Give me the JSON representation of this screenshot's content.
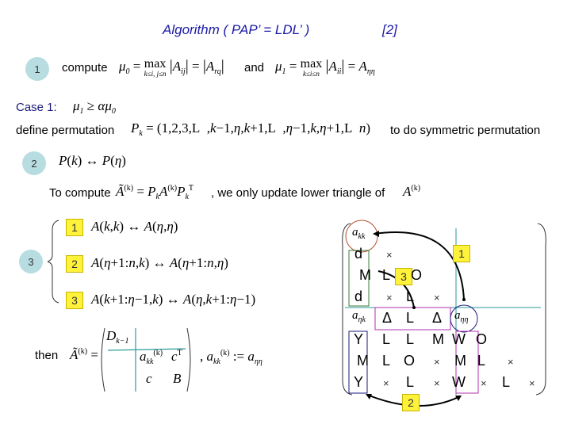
{
  "title": "Algorithm ( PAP’ = LDL’ )",
  "reference": "[2]",
  "step1": {
    "badge": "1",
    "label": "compute",
    "mu0_lhs": "μ₀ =",
    "max_op": "max",
    "mu0_limits": "k≤i, j≤n",
    "mu0_rhs": "|A_ij| = |A_rq|",
    "and_label": "and",
    "mu1_lhs": "μ₁ =",
    "mu1_limits": "k≤i≤n",
    "mu1_rhs": "|A_ii| = A_ηη"
  },
  "case1": {
    "label": "Case 1:",
    "condition": "μ₁ ≥ αμ₀"
  },
  "permutation": {
    "label": "define permutation",
    "formula": "P_k = (1,2,3,L ,k−1,η,k+1,L ,η−1,k,η+1,L n)",
    "suffix": "to do symmetric permutation"
  },
  "step2": {
    "badge": "2",
    "formula": "P(k) ↔ P(η)"
  },
  "compute": {
    "label": "To compute",
    "formula": "Ã(k) = P_k A(k) P_kᵀ",
    "suffix": ", we only update lower triangle of",
    "target": "A(k)"
  },
  "step3": {
    "badge": "3",
    "substeps": [
      {
        "badge": "1",
        "formula": "A(k,k) ↔ A(η,η)"
      },
      {
        "badge": "2",
        "formula": "A(η+1:n,k) ↔ A(η+1:n,η)"
      },
      {
        "badge": "3",
        "formula": "A(k+1:η−1,k) ↔ A(η,k+1:η−1)"
      }
    ]
  },
  "then": {
    "label": "then",
    "lhs": "Ã(k) =",
    "block_tl": "D_k−1",
    "block_akk": "a_kk(k)",
    "block_cT": "cᵀ",
    "block_c": "c",
    "block_B": "B",
    "assign": ", a_kk(k) := a_ηη"
  },
  "diagram": {
    "a_kk": "a_kk",
    "a_etak": "a_ηk",
    "a_etaeta": "a_ηη",
    "labels": [
      "1",
      "2",
      "3"
    ],
    "rows": [
      [
        "d",
        "×"
      ],
      [
        "M",
        "L",
        "O"
      ],
      [
        "d",
        "×",
        "L",
        "×"
      ],
      [
        "Δ",
        "L",
        "Δ"
      ],
      [
        "Y",
        "L",
        "L",
        "M",
        "W",
        "O"
      ],
      [
        "M",
        "L",
        "O",
        "×",
        "M",
        "L",
        "×"
      ],
      [
        "Y",
        "×",
        "L",
        "×",
        "W",
        "×",
        "L",
        "×"
      ]
    ]
  },
  "colors": {
    "title": "#1a1aa6",
    "step_circle": "#b7dde1",
    "step_box": "#fff23a",
    "teal_line": "#2a9a9a",
    "akk_circle": "#b05030",
    "aetaeta_circle": "#1a1a7a",
    "green_box": "#3a7a3a",
    "purple_box": "#b030b0",
    "navy_box": "#1a1a7a"
  }
}
